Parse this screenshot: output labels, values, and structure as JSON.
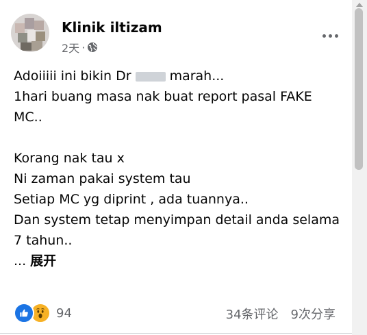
{
  "post": {
    "author": "Klinik iltizam",
    "time": "2天",
    "separator": "·",
    "privacy_icon": "globe-icon",
    "more_icon": "more-horizontal-icon",
    "text": {
      "line1_before": "Adoiiiii ini bikin Dr",
      "line1_after": "marah...",
      "line2": "1hari buang masa nak buat report pasal FAKE",
      "line3": "MC..",
      "line4": "Korang nak tau x",
      "line5": "Ni zaman pakai system tau",
      "line6": "Setiap MC yg diprint , ada tuannya..",
      "line7": "Dan system tetap menyimpan detail anda selama",
      "line8": "7 tahun..",
      "ellipsis": "...",
      "see_more": "展开"
    },
    "reactions": {
      "types": [
        "like-icon",
        "wow-icon"
      ],
      "count": "94"
    },
    "comments": "34条评论",
    "shares": "9次分享"
  },
  "colors": {
    "like_blue": "#1b74e4",
    "wow_yellow": "#f7b125",
    "secondary_text": "#65676b"
  }
}
